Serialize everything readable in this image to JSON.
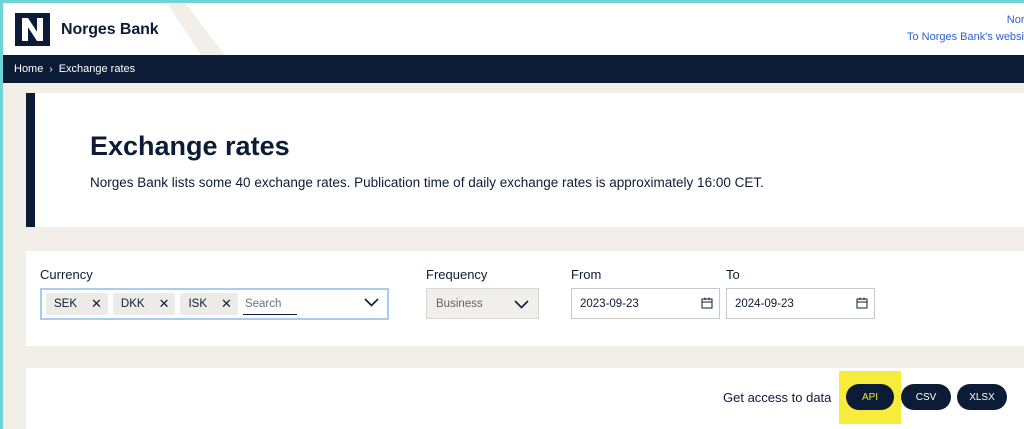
{
  "header": {
    "brand": "Norges Bank",
    "links": [
      "Nors",
      "To Norges Bank's websi"
    ]
  },
  "breadcrumb": {
    "home": "Home",
    "separator": "›",
    "current": "Exchange rates"
  },
  "hero": {
    "title": "Exchange rates",
    "description": "Norges Bank lists some 40 exchange rates. Publication time of daily exchange rates is approximately 16:00 CET."
  },
  "filters": {
    "currency_label": "Currency",
    "chips": [
      "SEK",
      "DKK",
      "ISK"
    ],
    "remove_glyph": "✕",
    "search_placeholder": "Search",
    "frequency_label": "Frequency",
    "frequency_value": "Business",
    "from_label": "From",
    "from_value": "2023-09-23",
    "to_label": "To",
    "to_value": "2024-09-23"
  },
  "access": {
    "label": "Get access to data",
    "buttons": [
      "API",
      "CSV",
      "XLSX"
    ]
  },
  "colors": {
    "navy": "#0c1c36",
    "highlight": "#f7ec3b",
    "link": "#2d5fd3",
    "page_bg": "#f2efe8"
  }
}
